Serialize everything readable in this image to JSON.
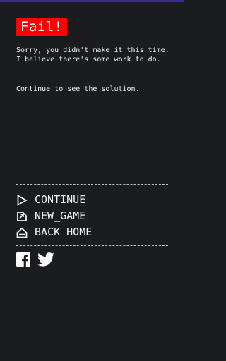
{
  "result": {
    "title": "Fail!",
    "message": "Sorry, you didn't make it this time. I believe there's some work to do.",
    "hint": "Continue to see the solution."
  },
  "menu": {
    "items": [
      {
        "label": "CONTINUE",
        "icon": "play-triangle-icon"
      },
      {
        "label": "NEW_GAME",
        "icon": "new-game-icon"
      },
      {
        "label": "BACK_HOME",
        "icon": "home-icon"
      }
    ]
  },
  "social": {
    "items": [
      {
        "icon": "facebook-icon"
      },
      {
        "icon": "twitter-icon"
      }
    ]
  },
  "colors": {
    "background": "#1b1c1f",
    "accent": "#ff0000",
    "text": "#f2f2f2",
    "top_bar": "#3d2a8c"
  }
}
